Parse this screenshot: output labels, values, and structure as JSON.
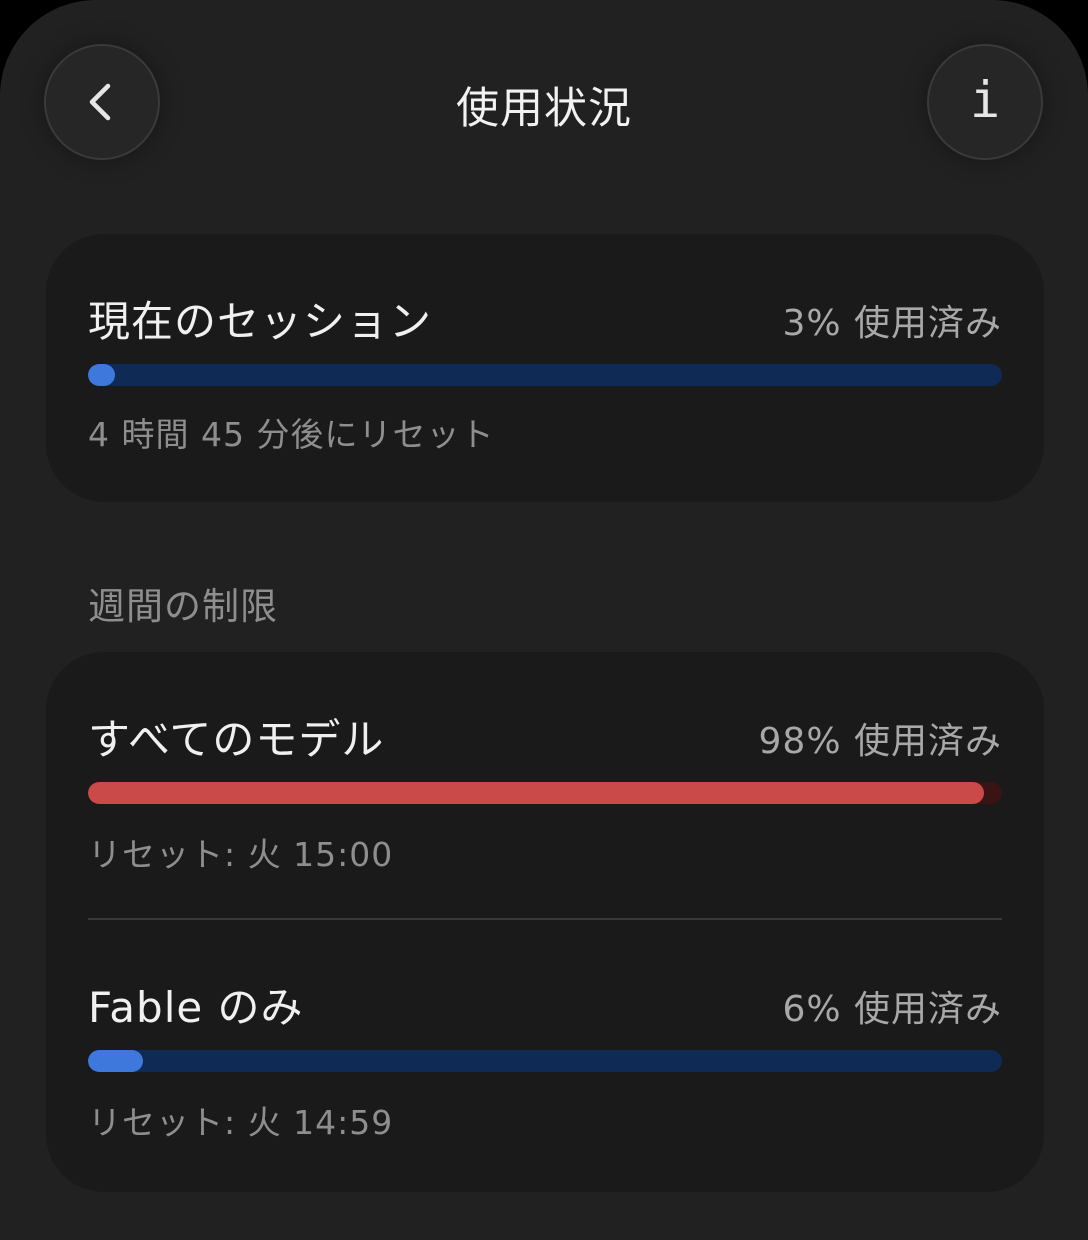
{
  "header": {
    "title": "使用状況",
    "back_icon": "chevron-left-icon",
    "info_icon": "info-icon",
    "info_glyph": "i"
  },
  "session": {
    "label": "現在のセッション",
    "percent_text": "3% 使用済み",
    "percent": 3,
    "reset_text": "4 時間 45 分後にリセット",
    "bar_color": "#3f78dd",
    "track_color": "#0f2a55"
  },
  "weekly": {
    "heading": "週間の制限",
    "items": [
      {
        "label": "すべてのモデル",
        "percent_text": "98% 使用済み",
        "percent": 98,
        "reset_text": "リセット: 火 15:00",
        "bar_color": "#c94a48",
        "track_color": "#3a1414"
      },
      {
        "label": "Fable のみ",
        "percent_text": "6% 使用済み",
        "percent": 6,
        "reset_text": "リセット: 火 14:59",
        "bar_color": "#3f78dd",
        "track_color": "#0f2a55"
      }
    ]
  },
  "colors": {
    "background": "#212121",
    "card": "#1a1a1a",
    "primary_text": "#f0f0f0",
    "secondary_text": "#8e8e8e"
  }
}
